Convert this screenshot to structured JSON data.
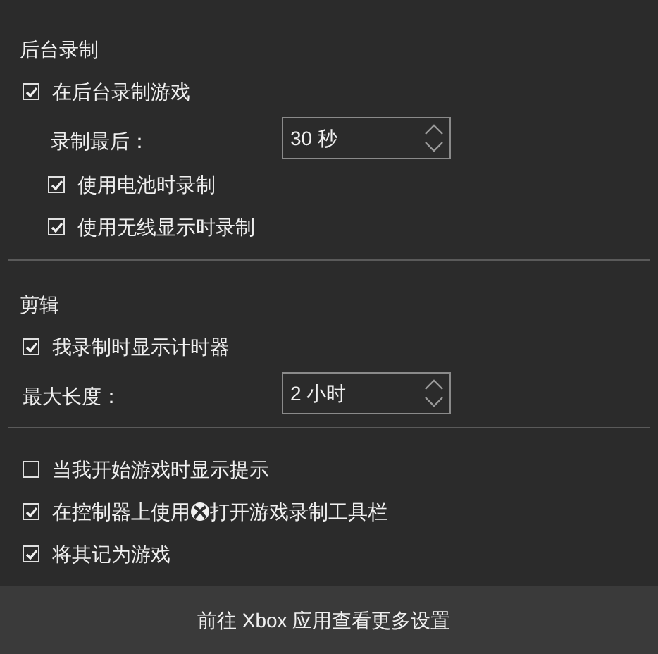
{
  "sections": [
    {
      "title": "后台录制",
      "items": [
        {
          "kind": "checkbox",
          "label": "在后台录制游戏",
          "checked": true,
          "children": [
            {
              "kind": "spinner",
              "label": "录制最后：",
              "value": "30 秒"
            },
            {
              "kind": "checkbox",
              "label": "使用电池时录制",
              "checked": true
            },
            {
              "kind": "checkbox",
              "label": "使用无线显示时录制",
              "checked": true
            }
          ]
        }
      ]
    },
    {
      "title": "剪辑",
      "items": [
        {
          "kind": "checkbox",
          "label": "我录制时显示计时器",
          "checked": true
        },
        {
          "kind": "spinner",
          "label": "最大长度：",
          "value": "2 小时"
        }
      ]
    },
    {
      "items": [
        {
          "kind": "checkbox",
          "label": "当我开始游戏时显示提示",
          "checked": false
        },
        {
          "kind": "checkbox",
          "label": "在控制器上使用",
          "label_after": "打开游戏录制工具栏",
          "checked": true
        },
        {
          "kind": "checkbox",
          "label": "将其记为游戏",
          "checked": true
        }
      ]
    }
  ],
  "footer": {
    "link": "前往 Xbox 应用查看更多设置"
  }
}
